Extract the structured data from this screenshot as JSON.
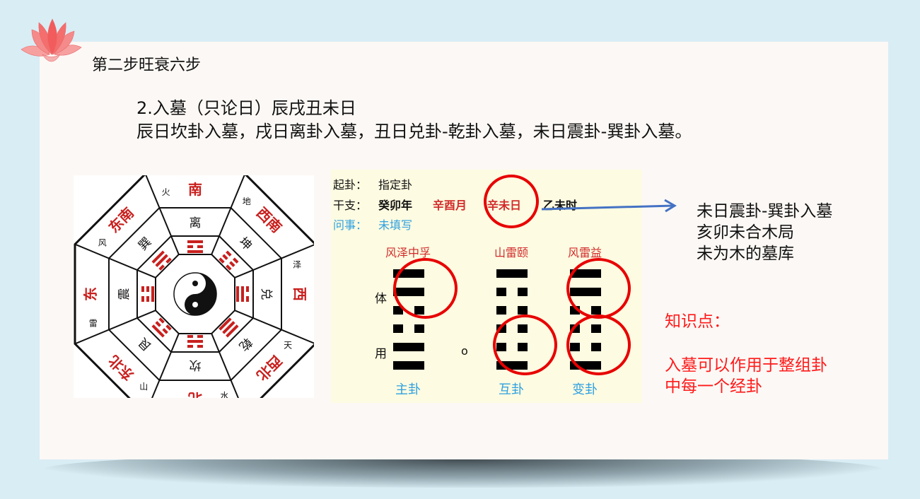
{
  "slide": {
    "title": "第二步旺衰六步",
    "heading": "2.入墓（只论日）辰戌丑未日",
    "rule": "辰日坎卦入墓，戌日离卦入墓，丑日兑卦-乾卦入墓，未日震卦-巽卦入墓。"
  },
  "bagua": {
    "directions": [
      "南",
      "西南",
      "西",
      "西北",
      "北",
      "东北",
      "东",
      "东南"
    ],
    "trigrams": [
      "离",
      "坤",
      "兑",
      "乾",
      "坎",
      "艮",
      "震",
      "巽"
    ],
    "elements": [
      "火",
      "地",
      "泽",
      "天",
      "水",
      "山",
      "雷",
      "风"
    ]
  },
  "panel": {
    "qigua_label": "起卦：",
    "qigua_value": "指定卦",
    "ganzhi_label": "干支：",
    "year": "癸卯年",
    "month": "辛酉月",
    "day": "辛未日",
    "hour": "乙未时",
    "wenshi_label": "问事：",
    "wenshi_value": "未填写",
    "ti_label": "体",
    "yong_label": "用",
    "moving_mark": "o",
    "hexagrams": [
      {
        "name": "风泽中孚",
        "caption": "主卦",
        "lines": [
          1,
          1,
          0,
          0,
          1,
          1
        ]
      },
      {
        "name": "山雷颐",
        "caption": "互卦",
        "lines": [
          1,
          0,
          0,
          0,
          0,
          1
        ]
      },
      {
        "name": "风雷益",
        "caption": "变卦",
        "lines": [
          1,
          1,
          0,
          0,
          0,
          1
        ]
      }
    ]
  },
  "notes": {
    "lines": [
      "未日震卦-巽卦入墓",
      "亥卯未合木局",
      "未为木的墓库"
    ],
    "knowledge_title": "知识点：",
    "knowledge_lines": [
      "入墓可以作用于整组卦",
      "中每一个经卦"
    ]
  },
  "colors": {
    "background": "#d9edf5",
    "slide": "#fcf8f5",
    "accent_red": "#ff1a1a",
    "arrow_blue": "#4472c4",
    "panel": "#fdfbe1"
  }
}
